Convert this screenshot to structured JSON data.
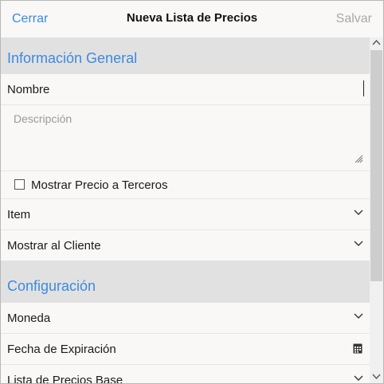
{
  "header": {
    "cancel_label": "Cerrar",
    "title": "Nueva Lista de Precios",
    "save_label": "Salvar"
  },
  "general": {
    "title": "Información General",
    "name_value": "Nombre",
    "description_placeholder": "Descripción",
    "show_price_label": "Mostrar Precio a Terceros",
    "show_price_checked": false,
    "item_label": "Item",
    "show_client_label": "Mostrar al Cliente"
  },
  "config": {
    "title": "Configuración",
    "currency_label": "Moneda",
    "expiration_label": "Fecha de Expiración",
    "base_list_label": "Lista de Precios Base"
  },
  "icons": {
    "chevron": "chevron-down-icon",
    "calendar": "calendar-icon",
    "resize": "resize-grip-icon"
  },
  "colors": {
    "accent": "#3a8be0",
    "section_bg": "#e2e1e2",
    "disabled": "#a8a8a8"
  }
}
